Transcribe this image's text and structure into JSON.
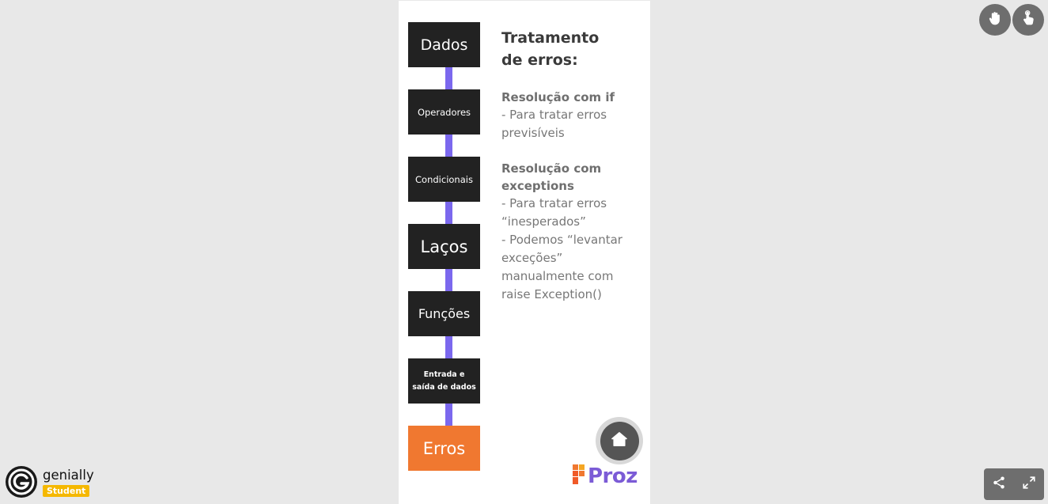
{
  "slide": {
    "timeline": [
      {
        "label": "Dados",
        "active": false
      },
      {
        "label": "Operadores",
        "active": false
      },
      {
        "label": "Condicionais",
        "active": false
      },
      {
        "label": "Laços",
        "active": false
      },
      {
        "label": "Funções",
        "active": false
      },
      {
        "label": "Entrada e\nsaída de dados",
        "active": false
      },
      {
        "label": "Erros",
        "active": true
      }
    ],
    "content": {
      "title": "Tratamento\nde erros:",
      "sections": [
        {
          "heading": "Resolução com if",
          "body": "- Para tratar erros\nprevisíveis"
        },
        {
          "heading": "Resolução com\nexceptions",
          "body": "- Para tratar erros\n“inesperados”\n- Podemos “levantar\nexceções”\nmanualmente com\nraise Exception()"
        }
      ]
    },
    "home_button": {
      "icon": "home-icon"
    },
    "logo": {
      "text": "Proz"
    }
  },
  "controls": {
    "top_right": [
      {
        "icon": "hand-icon"
      },
      {
        "icon": "pointer-hand-icon"
      }
    ],
    "bottom_right": [
      {
        "icon": "share-icon"
      },
      {
        "icon": "fullscreen-icon"
      }
    ]
  },
  "branding": {
    "name": "genially",
    "badge": "Student"
  },
  "colors": {
    "timeline_line": "#7b68ee",
    "box": "#222222",
    "active_box": "#f07830",
    "proz_purple": "#7b5bd6",
    "student_badge": "#f5b800"
  }
}
